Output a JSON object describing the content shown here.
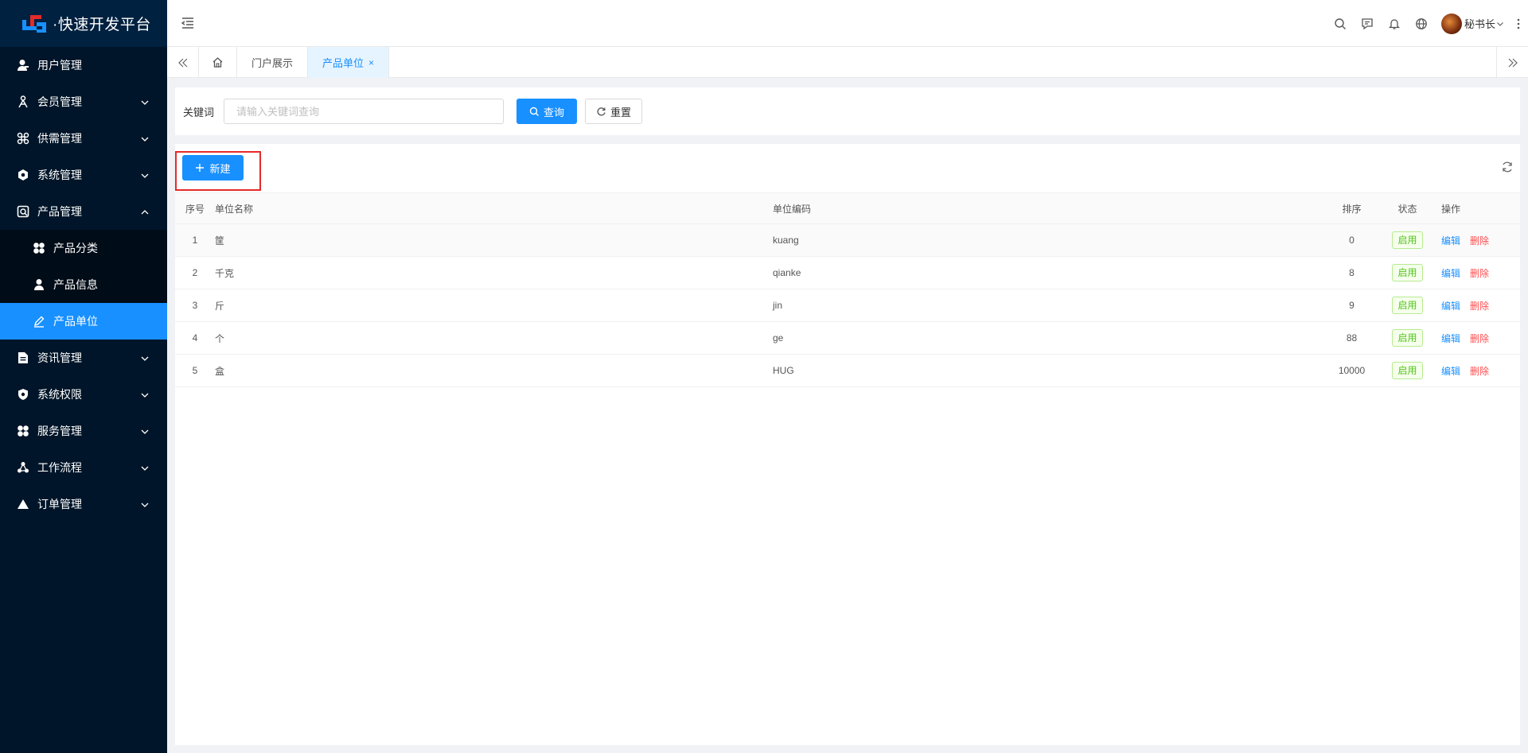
{
  "app": {
    "title": "·快速开发平台"
  },
  "sidebar": {
    "items": [
      {
        "label": "用户管理",
        "icon": "user-icon"
      },
      {
        "label": "会员管理",
        "icon": "member-icon"
      },
      {
        "label": "供需管理",
        "icon": "command-icon"
      },
      {
        "label": "系统管理",
        "icon": "gear-icon"
      },
      {
        "label": "产品管理",
        "icon": "product-icon"
      }
    ],
    "sub_items": [
      {
        "label": "产品分类",
        "icon": "category-icon"
      },
      {
        "label": "产品信息",
        "icon": "user-icon"
      },
      {
        "label": "产品单位",
        "icon": "edit-icon"
      }
    ],
    "items_after": [
      {
        "label": "资讯管理",
        "icon": "document-icon"
      },
      {
        "label": "系统权限",
        "icon": "shield-icon"
      },
      {
        "label": "服务管理",
        "icon": "grid-icon"
      },
      {
        "label": "工作流程",
        "icon": "workflow-icon"
      },
      {
        "label": "订单管理",
        "icon": "triangle-icon"
      }
    ]
  },
  "header": {
    "user_name": "秘书长"
  },
  "tabs": [
    {
      "label": "门户展示"
    },
    {
      "label": "产品单位",
      "close": "×"
    }
  ],
  "search": {
    "keyword_label": "关键词",
    "keyword_placeholder": "请输入关键词查询",
    "keyword_value": "",
    "search_label": "查询",
    "reset_label": "重置"
  },
  "toolbar": {
    "new_label": "新建"
  },
  "table": {
    "columns": [
      "序号",
      "单位名称",
      "单位编码",
      "排序",
      "状态",
      "操作"
    ],
    "rows": [
      {
        "index": "1",
        "name": "筐",
        "code": "kuang",
        "sort": "0",
        "status": "启用"
      },
      {
        "index": "2",
        "name": "千克",
        "code": "qianke",
        "sort": "8",
        "status": "启用"
      },
      {
        "index": "3",
        "name": "斤",
        "code": "jin",
        "sort": "9",
        "status": "启用"
      },
      {
        "index": "4",
        "name": "个",
        "code": "ge",
        "sort": "88",
        "status": "启用"
      },
      {
        "index": "5",
        "name": "盒",
        "code": "HUG",
        "sort": "10000",
        "status": "启用"
      }
    ],
    "edit_label": "编辑",
    "delete_label": "删除"
  },
  "colors": {
    "sidebar_bg": "#001529",
    "accent": "#1890ff",
    "danger": "#ff4d4f",
    "success": "#52c41a",
    "highlight": "#e52a2a"
  }
}
